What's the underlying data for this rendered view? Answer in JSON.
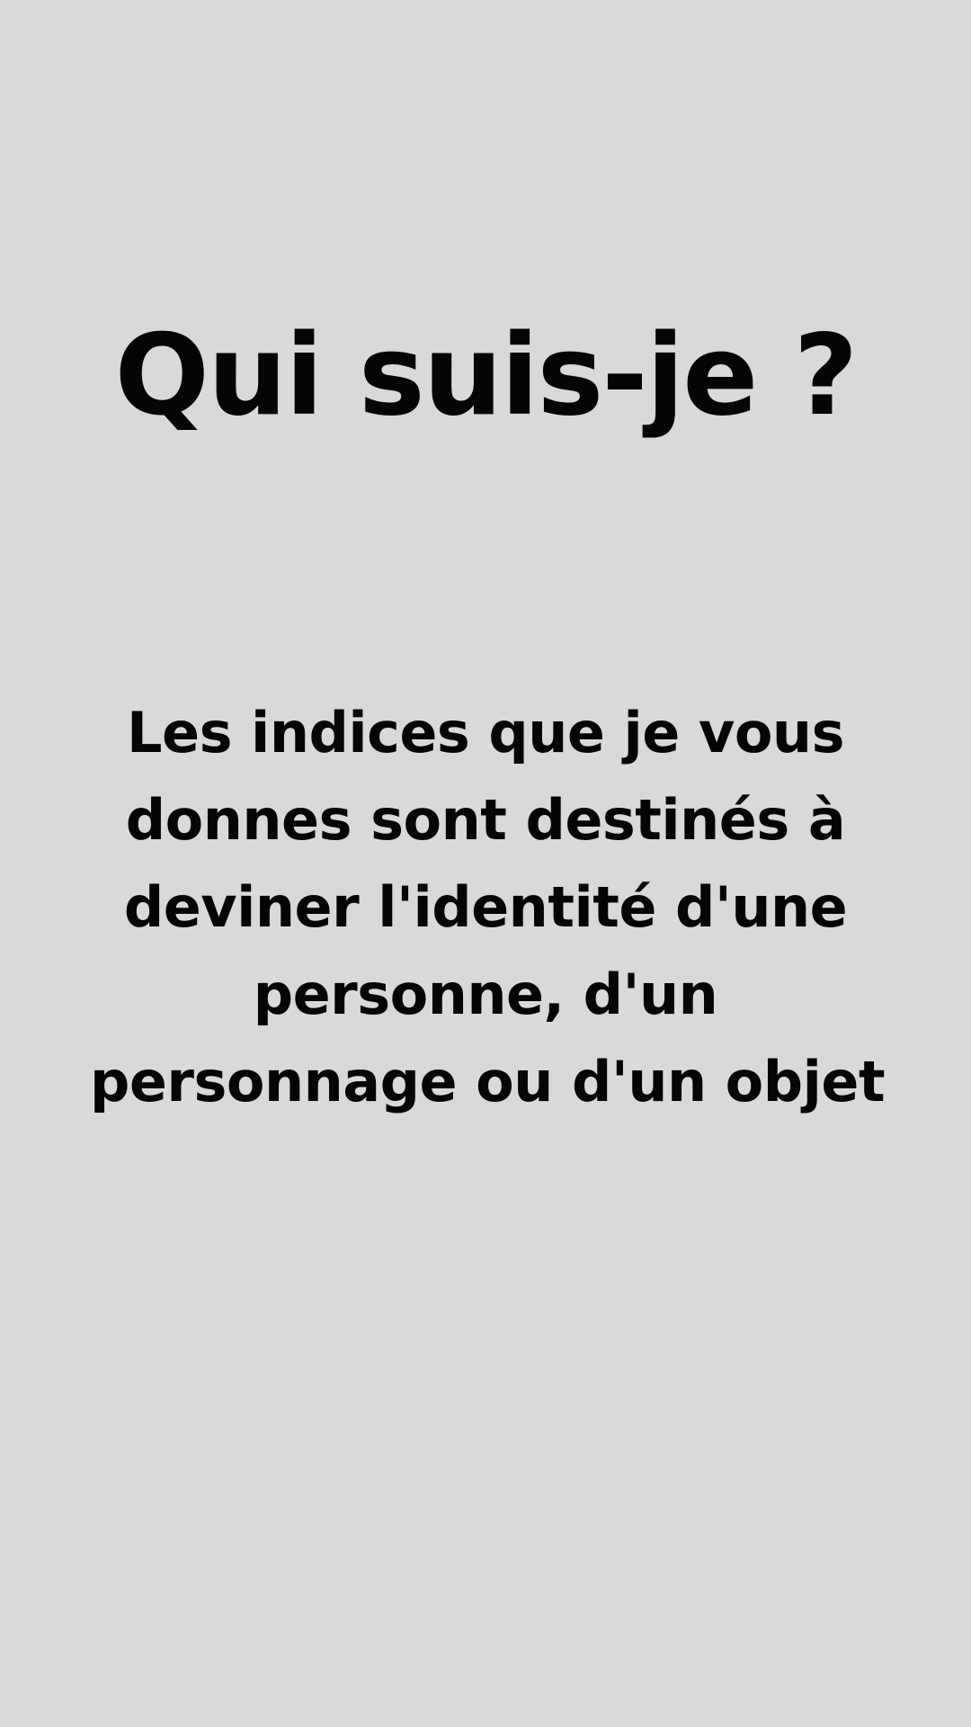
{
  "screen": {
    "background_color": "#d9d9d9",
    "text_color": "#050505"
  },
  "title": "Qui suis-je ?",
  "description": {
    "lines": [
      "Les indices que je vous",
      "donnes sont destinés à",
      "deviner l'identité d'une",
      "personne, d'un",
      "personnage ou d'un objet"
    ]
  }
}
